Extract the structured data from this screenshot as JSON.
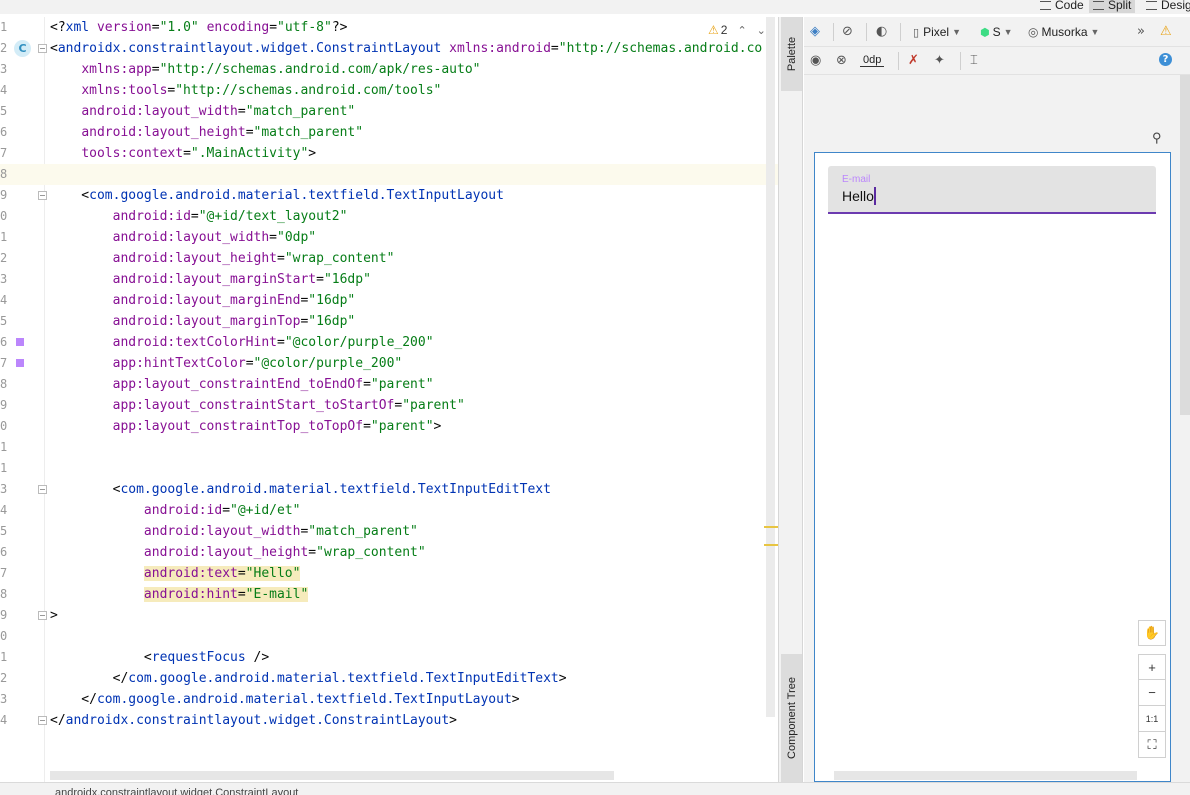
{
  "view_modes": {
    "code": "Code",
    "split": "Split",
    "design": "Desig"
  },
  "editor": {
    "warning_count": "2",
    "lines": [
      {
        "n": "1",
        "parts": [
          [
            "punc",
            "<?"
          ],
          [
            "tag",
            "xml "
          ],
          [
            "ns",
            "version"
          ],
          [
            "punc",
            "="
          ],
          [
            "val",
            "\"1.0\""
          ],
          [
            "punc",
            " "
          ],
          [
            "ns",
            "encoding"
          ],
          [
            "punc",
            "="
          ],
          [
            "val",
            "\"utf-8\""
          ],
          [
            "punc",
            "?>"
          ]
        ]
      },
      {
        "n": "2",
        "parts": [
          [
            "punc",
            "<"
          ],
          [
            "tag",
            "androidx.constraintlayout.widget.ConstraintLayout "
          ],
          [
            "ns",
            "xmlns:android"
          ],
          [
            "punc",
            "="
          ],
          [
            "val",
            "\"http://schemas.android.co"
          ]
        ]
      },
      {
        "n": "3",
        "parts": [
          [
            "punc",
            "    "
          ],
          [
            "ns",
            "xmlns:app"
          ],
          [
            "punc",
            "="
          ],
          [
            "val",
            "\"http://schemas.android.com/apk/res-auto\""
          ]
        ]
      },
      {
        "n": "4",
        "parts": [
          [
            "punc",
            "    "
          ],
          [
            "ns",
            "xmlns:tools"
          ],
          [
            "punc",
            "="
          ],
          [
            "val",
            "\"http://schemas.android.com/tools\""
          ]
        ]
      },
      {
        "n": "5",
        "parts": [
          [
            "punc",
            "    "
          ],
          [
            "ns",
            "android:layout_width"
          ],
          [
            "punc",
            "="
          ],
          [
            "val",
            "\"match_parent\""
          ]
        ]
      },
      {
        "n": "6",
        "parts": [
          [
            "punc",
            "    "
          ],
          [
            "ns",
            "android:layout_height"
          ],
          [
            "punc",
            "="
          ],
          [
            "val",
            "\"match_parent\""
          ]
        ]
      },
      {
        "n": "7",
        "parts": [
          [
            "punc",
            "    "
          ],
          [
            "ns",
            "tools:context"
          ],
          [
            "punc",
            "="
          ],
          [
            "val",
            "\".MainActivity\""
          ],
          [
            "punc",
            ">"
          ]
        ]
      },
      {
        "n": "8",
        "parts": []
      },
      {
        "n": "9",
        "parts": [
          [
            "punc",
            "    <"
          ],
          [
            "tag",
            "com.google.android.material.textfield.TextInputLayout"
          ]
        ]
      },
      {
        "n": "0",
        "parts": [
          [
            "punc",
            "        "
          ],
          [
            "ns",
            "android:id"
          ],
          [
            "punc",
            "="
          ],
          [
            "val",
            "\"@+id/text_layout2\""
          ]
        ]
      },
      {
        "n": "1",
        "parts": [
          [
            "punc",
            "        "
          ],
          [
            "ns",
            "android:layout_width"
          ],
          [
            "punc",
            "="
          ],
          [
            "val",
            "\"0dp\""
          ]
        ]
      },
      {
        "n": "2",
        "parts": [
          [
            "punc",
            "        "
          ],
          [
            "ns",
            "android:layout_height"
          ],
          [
            "punc",
            "="
          ],
          [
            "val",
            "\"wrap_content\""
          ]
        ]
      },
      {
        "n": "3",
        "parts": [
          [
            "punc",
            "        "
          ],
          [
            "ns",
            "android:layout_marginStart"
          ],
          [
            "punc",
            "="
          ],
          [
            "val",
            "\"16dp\""
          ]
        ]
      },
      {
        "n": "4",
        "parts": [
          [
            "punc",
            "        "
          ],
          [
            "ns",
            "android:layout_marginEnd"
          ],
          [
            "punc",
            "="
          ],
          [
            "val",
            "\"16dp\""
          ]
        ]
      },
      {
        "n": "5",
        "parts": [
          [
            "punc",
            "        "
          ],
          [
            "ns",
            "android:layout_marginTop"
          ],
          [
            "punc",
            "="
          ],
          [
            "val",
            "\"16dp\""
          ]
        ]
      },
      {
        "n": "6",
        "parts": [
          [
            "punc",
            "        "
          ],
          [
            "ns",
            "android:textColorHint"
          ],
          [
            "punc",
            "="
          ],
          [
            "val",
            "\"@color/purple_200\""
          ]
        ]
      },
      {
        "n": "7",
        "parts": [
          [
            "punc",
            "        "
          ],
          [
            "ns",
            "app:hintTextColor"
          ],
          [
            "punc",
            "="
          ],
          [
            "val",
            "\"@color/purple_200\""
          ]
        ]
      },
      {
        "n": "8",
        "parts": [
          [
            "punc",
            "        "
          ],
          [
            "ns",
            "app:layout_constraintEnd_toEndOf"
          ],
          [
            "punc",
            "="
          ],
          [
            "val",
            "\"parent\""
          ]
        ]
      },
      {
        "n": "9",
        "parts": [
          [
            "punc",
            "        "
          ],
          [
            "ns",
            "app:layout_constraintStart_toStartOf"
          ],
          [
            "punc",
            "="
          ],
          [
            "val",
            "\"parent\""
          ]
        ]
      },
      {
        "n": "0",
        "parts": [
          [
            "punc",
            "        "
          ],
          [
            "ns",
            "app:layout_constraintTop_toTopOf"
          ],
          [
            "punc",
            "="
          ],
          [
            "val",
            "\"parent\""
          ],
          [
            "punc",
            ">"
          ]
        ]
      },
      {
        "n": "1",
        "parts": []
      },
      {
        "n": "1",
        "parts": []
      },
      {
        "n": "3",
        "parts": [
          [
            "punc",
            "        <"
          ],
          [
            "tag",
            "com.google.android.material.textfield.TextInputEditText"
          ]
        ]
      },
      {
        "n": "4",
        "parts": [
          [
            "punc",
            "            "
          ],
          [
            "ns",
            "android:id"
          ],
          [
            "punc",
            "="
          ],
          [
            "val",
            "\"@+id/et\""
          ]
        ]
      },
      {
        "n": "5",
        "parts": [
          [
            "punc",
            "            "
          ],
          [
            "ns",
            "android:layout_width"
          ],
          [
            "punc",
            "="
          ],
          [
            "val",
            "\"match_parent\""
          ]
        ]
      },
      {
        "n": "6",
        "parts": [
          [
            "punc",
            "            "
          ],
          [
            "ns",
            "android:layout_height"
          ],
          [
            "punc",
            "="
          ],
          [
            "val",
            "\"wrap_content\""
          ]
        ]
      },
      {
        "n": "7",
        "parts": [
          [
            "punc",
            "            "
          ],
          [
            "hl-ns",
            "android:text"
          ],
          [
            "hl-punc",
            "="
          ],
          [
            "hl-val",
            "\"Hello\""
          ]
        ]
      },
      {
        "n": "8",
        "parts": [
          [
            "punc",
            "            "
          ],
          [
            "hl-ns",
            "android:hint"
          ],
          [
            "hl-punc",
            "="
          ],
          [
            "hl-val",
            "\"E-mail\""
          ]
        ]
      },
      {
        "n": "9",
        "parts": [
          [
            "punc",
            ">"
          ]
        ]
      },
      {
        "n": "0",
        "parts": []
      },
      {
        "n": "1",
        "parts": [
          [
            "punc",
            "            <"
          ],
          [
            "tag",
            "requestFocus "
          ],
          [
            "punc",
            "/>"
          ]
        ]
      },
      {
        "n": "2",
        "parts": [
          [
            "punc",
            "        </"
          ],
          [
            "tag",
            "com.google.android.material.textfield.TextInputEditText"
          ],
          [
            "punc",
            ">"
          ]
        ]
      },
      {
        "n": "3",
        "parts": [
          [
            "punc",
            "    </"
          ],
          [
            "tag",
            "com.google.android.material.textfield.TextInputLayout"
          ],
          [
            "punc",
            ">"
          ]
        ]
      },
      {
        "n": "4",
        "parts": [
          [
            "punc",
            "</"
          ],
          [
            "tag",
            "androidx.constraintlayout.widget.ConstraintLayout"
          ],
          [
            "punc",
            ">"
          ]
        ]
      }
    ]
  },
  "side_tabs": {
    "palette": "Palette",
    "component_tree": "Component Tree"
  },
  "design_toolbar": {
    "device": "Pixel",
    "api": "S",
    "theme": "Musorka",
    "default_margin": "0dp",
    "help": "?"
  },
  "preview": {
    "hint": "E-mail",
    "value": "Hello"
  },
  "zoom_controls": {
    "zoom_in": "+",
    "zoom_out": "−",
    "actual_size": "1:1"
  },
  "colors": {
    "hint": "#bb86fc",
    "underline": "#6c3bb0",
    "device_border": "#3f86c9",
    "warning": "#e8a317"
  },
  "status": {
    "breadcrumb": "androidx.constraintlayout.widget.ConstraintLayout"
  }
}
